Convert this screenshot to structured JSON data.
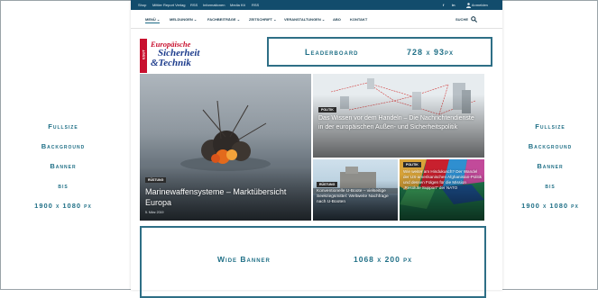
{
  "side_banner": {
    "lines": [
      "Fullsize",
      "Background",
      "Banner",
      "bis",
      "1900 x 1080 px"
    ]
  },
  "topbar": {
    "links": [
      "Shop",
      "Mittler Report Verlag",
      "RSS",
      "Informationen",
      "Media Kit",
      "RSS"
    ],
    "social": [
      "f",
      "in"
    ],
    "account": "Anmelden"
  },
  "nav": {
    "items": [
      "MENÜ",
      "MELDUNGEN",
      "FACHBEITRÄGE",
      "ZEITSCHRIFT",
      "VERANSTALTUNGEN",
      "ABO",
      "KONTAKT"
    ],
    "search_label": "SUCHE"
  },
  "logo": {
    "badge": "ESUT",
    "line1": "Europäische",
    "line2": "Sicherheit",
    "line3": "&Technik"
  },
  "leaderboard": {
    "label": "Leaderboard",
    "size": "728 x 93px"
  },
  "articles": [
    {
      "category": "RÜSTUNG",
      "title": "Marinewaffensysteme – Marktübersicht Europa",
      "date": "5. März 2019"
    },
    {
      "category": "POLITIK",
      "title": "Das Wissen vor dem Handeln – Die Nachrichtendienste in der europäischen Außen- und Sicherheitspolitik"
    },
    {
      "category": "RÜSTUNG",
      "title": "Konventionelle U-Boote – vielseitige Seekriegsmittel: Weltweite Nachfrage nach U-Booten"
    },
    {
      "category": "POLITIK",
      "title": "Wie weiter am Hindukusch? Der Wandel der US-amerikanischen Afghanistan-Politik und dessen Folgen für die Mission „Resolute Support\" der NATO"
    }
  ],
  "wide_banner": {
    "label": "Wide Banner",
    "size": "1068 x 200 px"
  },
  "colors": {
    "accent": "#1f6f86",
    "topbar": "#124c6c",
    "logo_red": "#c8102e",
    "logo_blue": "#1d3c8c"
  }
}
